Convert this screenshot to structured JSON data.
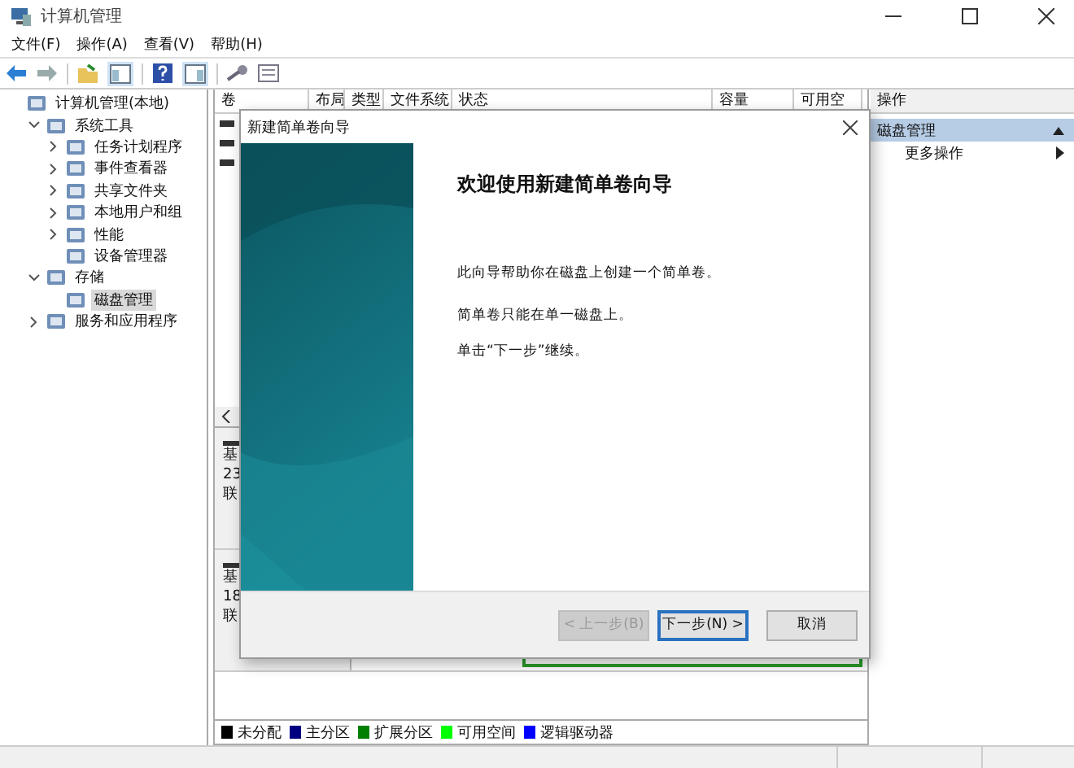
{
  "window": {
    "title": "计算机管理"
  },
  "menu": [
    "文件(F)",
    "操作(A)",
    "查看(V)",
    "帮助(H)"
  ],
  "tree": {
    "label": "计算机管理(本地)",
    "selected": false,
    "children": [
      {
        "label": "系统工具",
        "expanded": true,
        "selected": false,
        "children": [
          {
            "label": "任务计划程序",
            "expanded": false,
            "selected": false
          },
          {
            "label": "事件查看器",
            "expanded": false,
            "selected": false
          },
          {
            "label": "共享文件夹",
            "expanded": false,
            "selected": false
          },
          {
            "label": "本地用户和组",
            "expanded": false,
            "selected": false
          },
          {
            "label": "性能",
            "expanded": false,
            "selected": false
          },
          {
            "label": "设备管理器",
            "selected": false
          }
        ]
      },
      {
        "label": "存储",
        "expanded": true,
        "selected": false,
        "children": [
          {
            "label": "磁盘管理",
            "selected": true
          }
        ]
      },
      {
        "label": "服务和应用程序",
        "expanded": false,
        "selected": false
      }
    ]
  },
  "table": {
    "columns": [
      "卷",
      "布局",
      "类型",
      "文件系统",
      "状态",
      "容量",
      "可用空"
    ]
  },
  "disks": [
    {
      "lines": [
        "基",
        "23",
        "联"
      ]
    },
    {
      "lines": [
        "基",
        "18",
        "联"
      ]
    }
  ],
  "legend": [
    {
      "label": "未分配",
      "color": "#000000"
    },
    {
      "label": "主分区",
      "color": "#000080"
    },
    {
      "label": "扩展分区",
      "color": "#008000"
    },
    {
      "label": "可用空间",
      "color": "#00ff00"
    },
    {
      "label": "逻辑驱动器",
      "color": "#0000ff"
    }
  ],
  "actions": {
    "header": "操作",
    "section": "磁盘管理",
    "items": [
      "更多操作"
    ]
  },
  "dialog": {
    "title": "新建简单卷向导",
    "heading": "欢迎使用新建简单卷向导",
    "paragraphs": [
      "此向导帮助你在磁盘上创建一个简单卷。",
      "简单卷只能在单一磁盘上。",
      "单击“下一步”继续。"
    ],
    "buttons": [
      {
        "label": "< 上一步(B)",
        "disabled": true,
        "default": false
      },
      {
        "label": "下一步(N) >",
        "disabled": false,
        "default": true
      },
      {
        "label": "取消",
        "disabled": false,
        "default": false
      }
    ]
  }
}
